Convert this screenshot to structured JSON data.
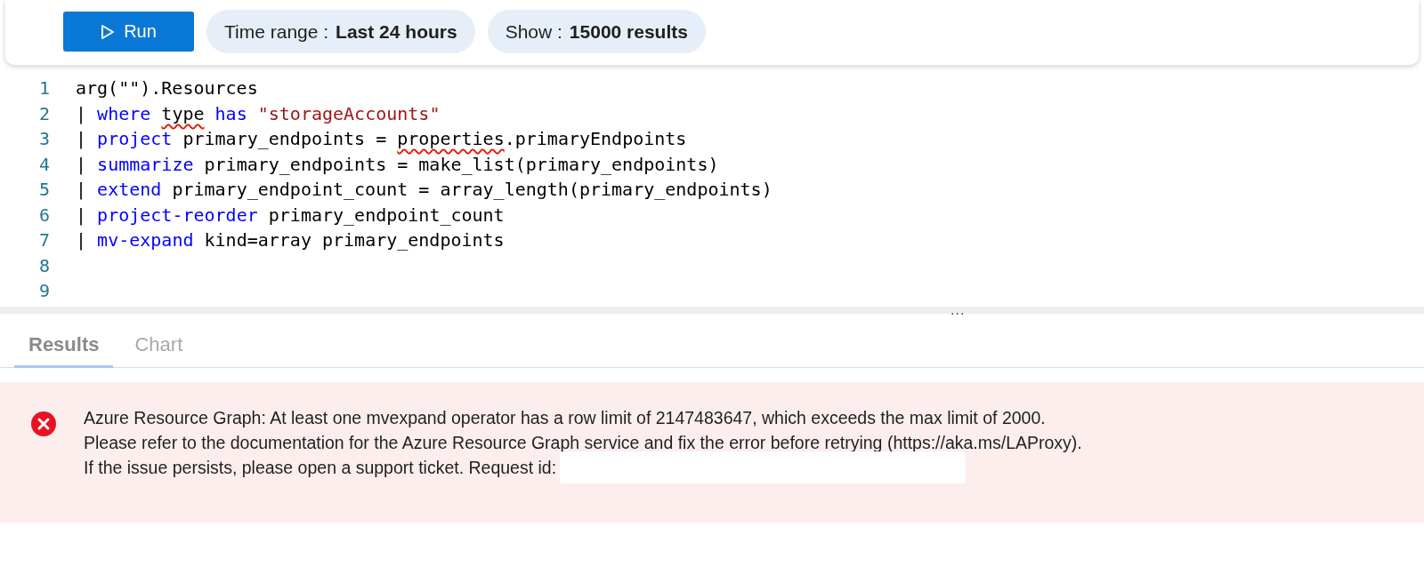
{
  "toolbar": {
    "run_button": "Run",
    "pills": [
      {
        "label": "Time range :",
        "value": "Last 24 hours"
      },
      {
        "label": "Show :",
        "value": "15000 results"
      }
    ]
  },
  "editor": {
    "lines": [
      {
        "number": "1",
        "tokens": [
          {
            "kind": "plain",
            "text": "arg(\"\").Resources"
          }
        ]
      },
      {
        "number": "2",
        "tokens": [
          {
            "kind": "plain",
            "text": "| "
          },
          {
            "kind": "keyword",
            "text": "where "
          },
          {
            "kind": "squiggle",
            "text": "type"
          },
          {
            "kind": "keyword",
            "text": " has "
          },
          {
            "kind": "string",
            "text": "\"storageAccounts\""
          }
        ]
      },
      {
        "number": "3",
        "tokens": [
          {
            "kind": "plain",
            "text": "| "
          },
          {
            "kind": "keyword",
            "text": "project"
          },
          {
            "kind": "plain",
            "text": " primary_endpoints = "
          },
          {
            "kind": "squiggle",
            "text": "properties"
          },
          {
            "kind": "plain",
            "text": ".primaryEndpoints"
          }
        ]
      },
      {
        "number": "4",
        "tokens": [
          {
            "kind": "plain",
            "text": "| "
          },
          {
            "kind": "keyword",
            "text": "summarize"
          },
          {
            "kind": "plain",
            "text": " primary_endpoints = make_list(primary_endpoints)"
          }
        ]
      },
      {
        "number": "5",
        "tokens": [
          {
            "kind": "plain",
            "text": "| "
          },
          {
            "kind": "keyword",
            "text": "extend"
          },
          {
            "kind": "plain",
            "text": " primary_endpoint_count = array_length(primary_endpoints)"
          }
        ]
      },
      {
        "number": "6",
        "tokens": [
          {
            "kind": "plain",
            "text": "| "
          },
          {
            "kind": "keyword",
            "text": "project-reorder"
          },
          {
            "kind": "plain",
            "text": " primary_endpoint_count"
          }
        ]
      },
      {
        "number": "7",
        "tokens": [
          {
            "kind": "plain",
            "text": "| "
          },
          {
            "kind": "keyword",
            "text": "mv-expand"
          },
          {
            "kind": "plain",
            "text": " kind=array primary_endpoints"
          }
        ]
      },
      {
        "number": "8"
      },
      {
        "number": "9"
      }
    ],
    "splitter": "..."
  },
  "tabs": [
    {
      "label": "Results",
      "selected": true
    },
    {
      "label": "Chart",
      "selected": false
    }
  ],
  "error": {
    "lines": [
      "Azure Resource Graph: At least one mvexpand operator has a row limit of 2147483647, which exceeds the max limit of 2000.",
      "Please refer to the documentation for the Azure Resource Graph service and fix the error before retrying (https://aka.ms/LAProxy).",
      "If the issue persists, please open a support ticket. Request id:"
    ]
  }
}
